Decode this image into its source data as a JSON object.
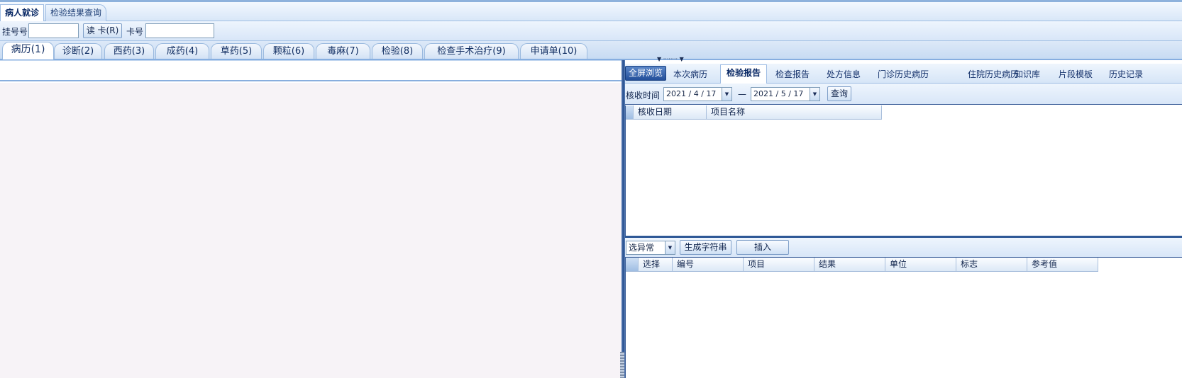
{
  "app_tabs": [
    {
      "label": "病人就诊",
      "active": true
    },
    {
      "label": "检验结果查询",
      "active": false
    }
  ],
  "patient_bar": {
    "registration_label": "挂号号",
    "registration_value": "",
    "read_card_button": "读 卡(R)",
    "card_label": "卡号",
    "card_value": ""
  },
  "module_tabs": [
    {
      "label": "病历(1)",
      "active": true
    },
    {
      "label": "诊断(2)",
      "active": false
    },
    {
      "label": "西药(3)",
      "active": false
    },
    {
      "label": "成药(4)",
      "active": false
    },
    {
      "label": "草药(5)",
      "active": false
    },
    {
      "label": "颗粒(6)",
      "active": false
    },
    {
      "label": "毒麻(7)",
      "active": false
    },
    {
      "label": "检验(8)",
      "active": false
    },
    {
      "label": "检查手术治疗(9)",
      "active": false
    },
    {
      "label": "申请单(10)",
      "active": false
    }
  ],
  "right_panel": {
    "fullscreen_button": "全屏浏览",
    "tabs": [
      {
        "label": "本次病历",
        "active": false
      },
      {
        "label": "检验报告",
        "active": true
      },
      {
        "label": "检查报告",
        "active": false
      },
      {
        "label": "处方信息",
        "active": false
      },
      {
        "label": "门诊历史病历",
        "active": false
      },
      {
        "label": "住院历史病历",
        "active": false
      },
      {
        "label": "知识库",
        "active": false
      },
      {
        "label": "片段模板",
        "active": false
      },
      {
        "label": "历史记录",
        "active": false
      }
    ],
    "range": {
      "label": "核收时间",
      "start_date": "2021 / 4 / 17",
      "separator": "—",
      "end_date": "2021 / 5 / 17",
      "query_button": "查询"
    },
    "report_grid": {
      "columns": [
        "核收日期",
        "项目名称"
      ],
      "rows": []
    },
    "result_toolbar": {
      "filter_value": "选异常",
      "generate_button": "生成字符串",
      "insert_button": "插入"
    },
    "result_grid": {
      "columns": [
        "选择",
        "编号",
        "项目",
        "结果",
        "单位",
        "标志",
        "参考值"
      ],
      "rows": []
    }
  },
  "icons": {
    "dropdown": "chevron-down-icon",
    "splitter": "splitter-grip-icon"
  },
  "colors": {
    "accent": "#2e5896",
    "tab_bg": "#d8e6f8",
    "editor_bg": "#f7f3f7",
    "fullscreen_button": "#234f9a"
  }
}
